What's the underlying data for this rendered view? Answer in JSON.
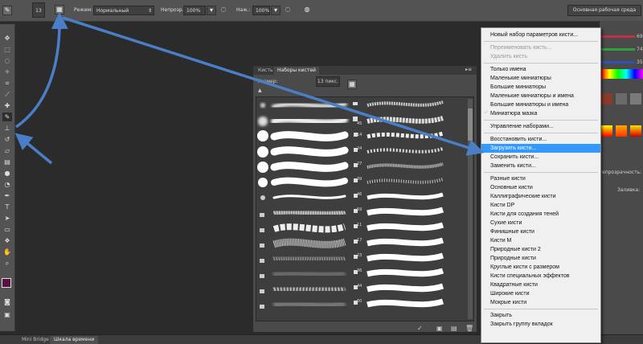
{
  "options_bar": {
    "brush_size": "13",
    "mode_label": "Режим:",
    "mode_value": "Нормальный",
    "opacity_label": "Непрозр.:",
    "opacity_value": "100%",
    "pressure_label": "Наж.:",
    "pressure_value": "100%",
    "workspace": "Основная рабочая среда"
  },
  "brush_panel": {
    "tabs": [
      "Кисть",
      "Наборы кистей"
    ],
    "size_label": "Размер:",
    "size_value": "13 пикс.",
    "numbers": [
      "45",
      "14",
      "24",
      "27",
      "39",
      "46",
      "59",
      "11",
      "17",
      "23",
      "36",
      "44",
      "60"
    ]
  },
  "right_panel": {
    "values": [
      "69",
      "74",
      "35"
    ],
    "label1": "епрозрачность:",
    "label2": "Заливка:"
  },
  "bottom_tabs": [
    "Mini Bridge",
    "Шкала времени"
  ],
  "menu": {
    "items": [
      {
        "label": "Новый набор параметров кисти...",
        "state": "normal"
      },
      {
        "label": "Переименовать кисть...",
        "state": "disabled"
      },
      {
        "label": "Удалить кисть",
        "state": "disabled"
      },
      {
        "label": "Только имена",
        "state": "normal"
      },
      {
        "label": "Маленькие миниатюры",
        "state": "normal"
      },
      {
        "label": "Большие миниатюры",
        "state": "normal"
      },
      {
        "label": "Маленькие миниатюры и имена",
        "state": "normal"
      },
      {
        "label": "Большие миниатюры и имена",
        "state": "normal"
      },
      {
        "label": "Миниатюра мазка",
        "state": "checked"
      },
      {
        "label": "Управление наборами...",
        "state": "normal"
      },
      {
        "label": "Восстановить кисти...",
        "state": "normal"
      },
      {
        "label": "Загрузить кисти...",
        "state": "highlighted"
      },
      {
        "label": "Сохранить кисти...",
        "state": "normal"
      },
      {
        "label": "Заменить кисти...",
        "state": "normal"
      },
      {
        "label": "Разные кисти",
        "state": "normal"
      },
      {
        "label": "Основные кисти",
        "state": "normal"
      },
      {
        "label": "Каллиграфические кисти",
        "state": "normal"
      },
      {
        "label": "Кисти DP",
        "state": "normal"
      },
      {
        "label": "Кисти для создания теней",
        "state": "normal"
      },
      {
        "label": "Сухие кисти",
        "state": "normal"
      },
      {
        "label": "Финишные кисти",
        "state": "normal"
      },
      {
        "label": "Кисти М",
        "state": "normal"
      },
      {
        "label": "Природные кисти 2",
        "state": "normal"
      },
      {
        "label": "Природные кисти",
        "state": "normal"
      },
      {
        "label": "Круглые кисти с размером",
        "state": "normal"
      },
      {
        "label": "Кисти специальных эффектов",
        "state": "normal"
      },
      {
        "label": "Квадратные кисти",
        "state": "normal"
      },
      {
        "label": "Широкие кисти",
        "state": "normal"
      },
      {
        "label": "Мокрые кисти",
        "state": "normal"
      },
      {
        "label": "Закрыть",
        "state": "normal"
      },
      {
        "label": "Закрыть группу вкладок",
        "state": "normal"
      }
    ]
  },
  "colors": {
    "highlight": "#3399ff",
    "arrow": "#4a7fc8",
    "foreground": "#5a1040"
  }
}
